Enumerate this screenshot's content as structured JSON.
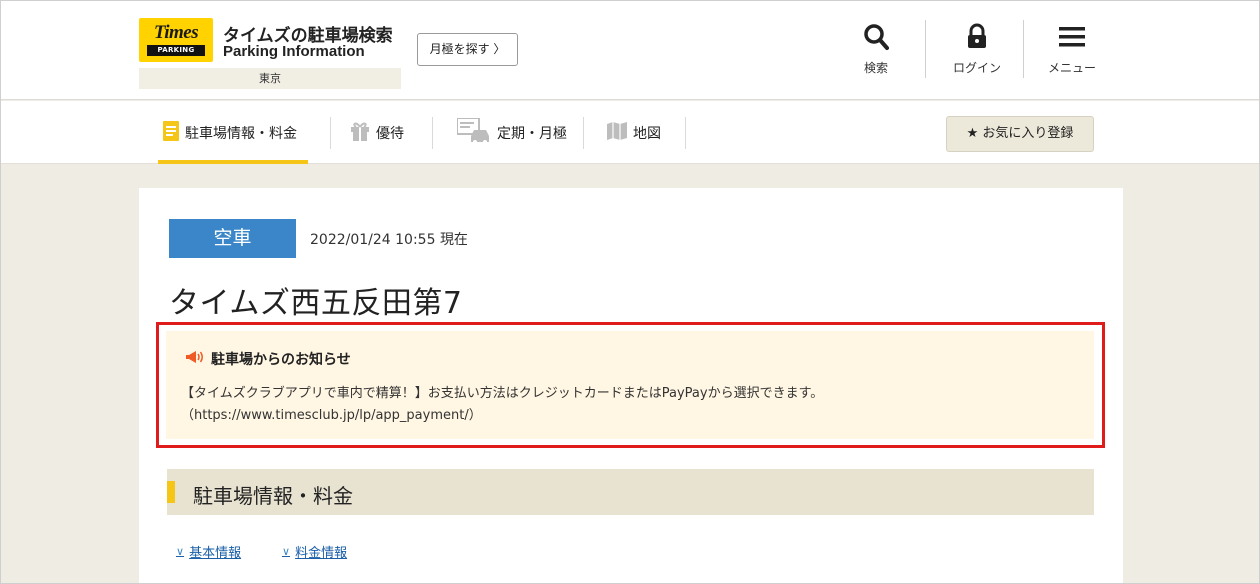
{
  "header": {
    "logo_main": "Times",
    "logo_sub": "PARKING",
    "site_title": "タイムズの駐車場検索",
    "site_subtitle": "Parking Information",
    "area": "東京",
    "monthly_button": "月極を探す 〉",
    "icons": [
      {
        "name": "search-icon",
        "label": "検索"
      },
      {
        "name": "lock-icon",
        "label": "ログイン"
      },
      {
        "name": "menu-icon",
        "label": "メニュー"
      }
    ]
  },
  "nav": {
    "items": [
      {
        "label": "駐車場情報・料金",
        "icon": "document-icon",
        "active": true
      },
      {
        "label": "優待",
        "icon": "gift-icon",
        "active": false
      },
      {
        "label": "定期・月極",
        "icon": "car-calendar-icon",
        "active": false
      },
      {
        "label": "地図",
        "icon": "map-icon",
        "active": false
      }
    ],
    "favorite_button": "お気に入り登録",
    "favorite_icon": "star-icon"
  },
  "status": {
    "badge": "空車",
    "badge_color": "#3a86c8",
    "timestamp": "2022/01/24 10:55 現在"
  },
  "lot": {
    "name": "タイムズ西五反田第7"
  },
  "notice": {
    "title": "駐車場からのお知らせ",
    "icon": "megaphone-icon",
    "line1": "【タイムズクラブアプリで車内で精算！】お支払い方法はクレジットカードまたはPayPayから選択できます。",
    "line2": "（https://www.timesclub.jp/lp/app_payment/）",
    "highlight_color": "#e01b1b"
  },
  "section": {
    "title": "駐車場情報・料金"
  },
  "anchors": [
    {
      "label": "基本情報"
    },
    {
      "label": "料金情報"
    }
  ],
  "colors": {
    "accent_yellow": "#f5c518",
    "link_blue": "#1a5fa8",
    "page_bg": "#efece3"
  }
}
